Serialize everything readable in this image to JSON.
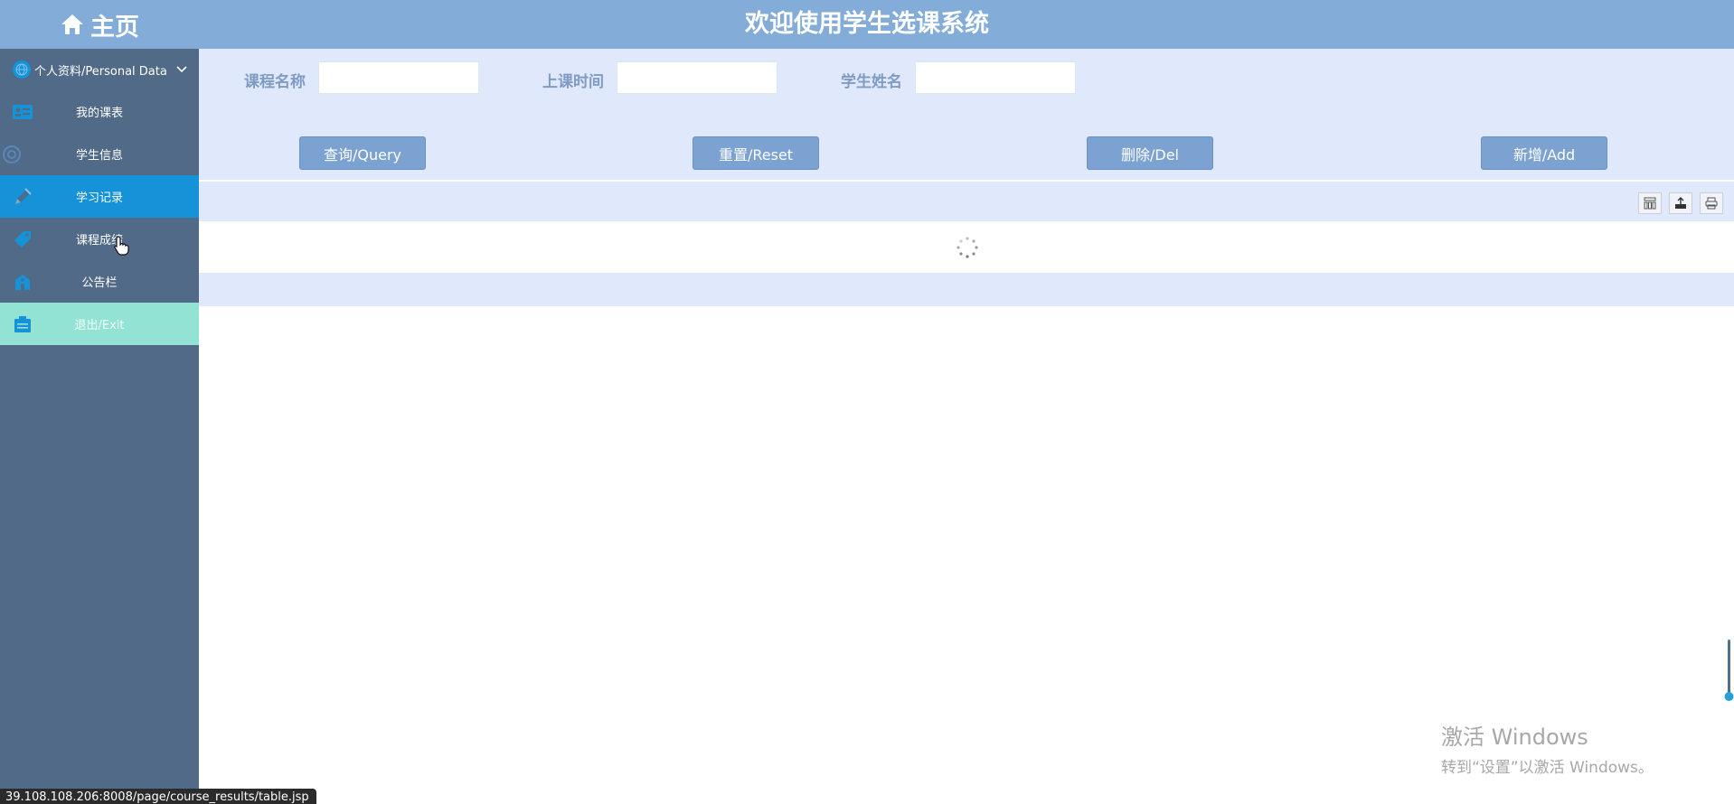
{
  "logo": {
    "text": "主页",
    "icon": "home-icon"
  },
  "header": {
    "title": "欢迎使用学生选课系统"
  },
  "sidebar": {
    "profile": {
      "label": "个人资料/Personal Data",
      "icon": "globe-icon"
    },
    "items": [
      {
        "label": "我的课表",
        "icon": "id-card-icon"
      },
      {
        "label": "学生信息",
        "icon": "settings-icon"
      },
      {
        "label": "学习记录",
        "icon": "pencil-icon",
        "active": true
      },
      {
        "label": "课程成绩",
        "icon": "tag-icon"
      },
      {
        "label": "公告栏",
        "icon": "building-icon"
      },
      {
        "label": "退出/Exit",
        "icon": "exit-icon"
      }
    ]
  },
  "search": {
    "course_name_label": "课程名称",
    "course_name_value": "",
    "class_time_label": "上课时间",
    "class_time_value": "",
    "student_name_label": "学生姓名",
    "student_name_value": ""
  },
  "buttons": {
    "query": "查询/Query",
    "reset": "重置/Reset",
    "delete": "删除/Del",
    "add": "新增/Add"
  },
  "watermark": {
    "line1": "激活 Windows",
    "line2": "转到“设置”以激活 Windows。"
  },
  "status_bar": {
    "url": "39.108.108.206:8008/page/course_results/table.jsp"
  },
  "colors": {
    "header": "#83add8",
    "sidebar": "#516a87",
    "active_item": "#1592d8",
    "exit_item": "#93e3d4",
    "panel": "#e0e8fc",
    "button": "#7ba2d1"
  }
}
